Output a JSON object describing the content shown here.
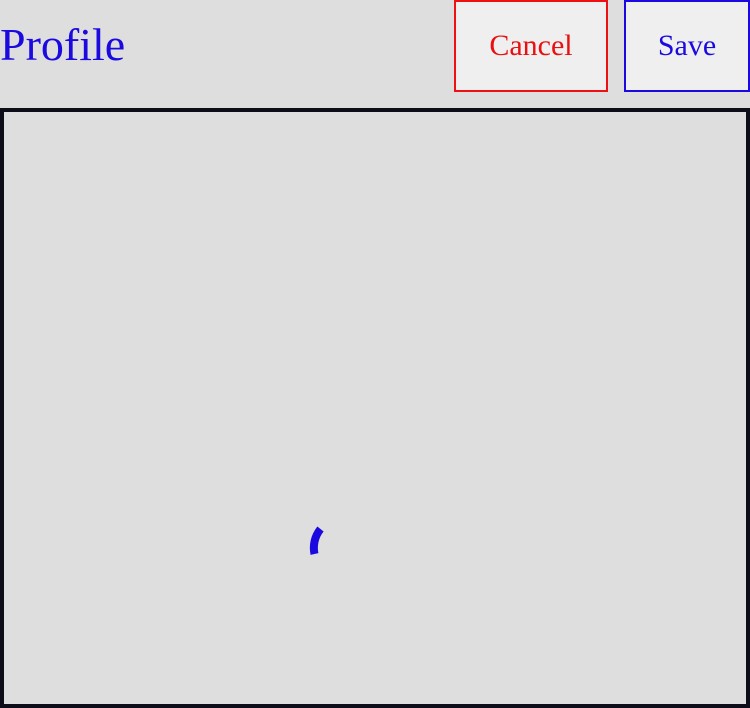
{
  "header": {
    "title": "Profile",
    "cancel_label": "Cancel",
    "save_label": "Save"
  },
  "content": {
    "state": "loading",
    "spinner_icon": "loading-spinner-icon"
  },
  "colors": {
    "accent": "#1a0ae0",
    "danger": "#e81010",
    "background": "#dedede",
    "frame_border": "#0d0d1a"
  }
}
